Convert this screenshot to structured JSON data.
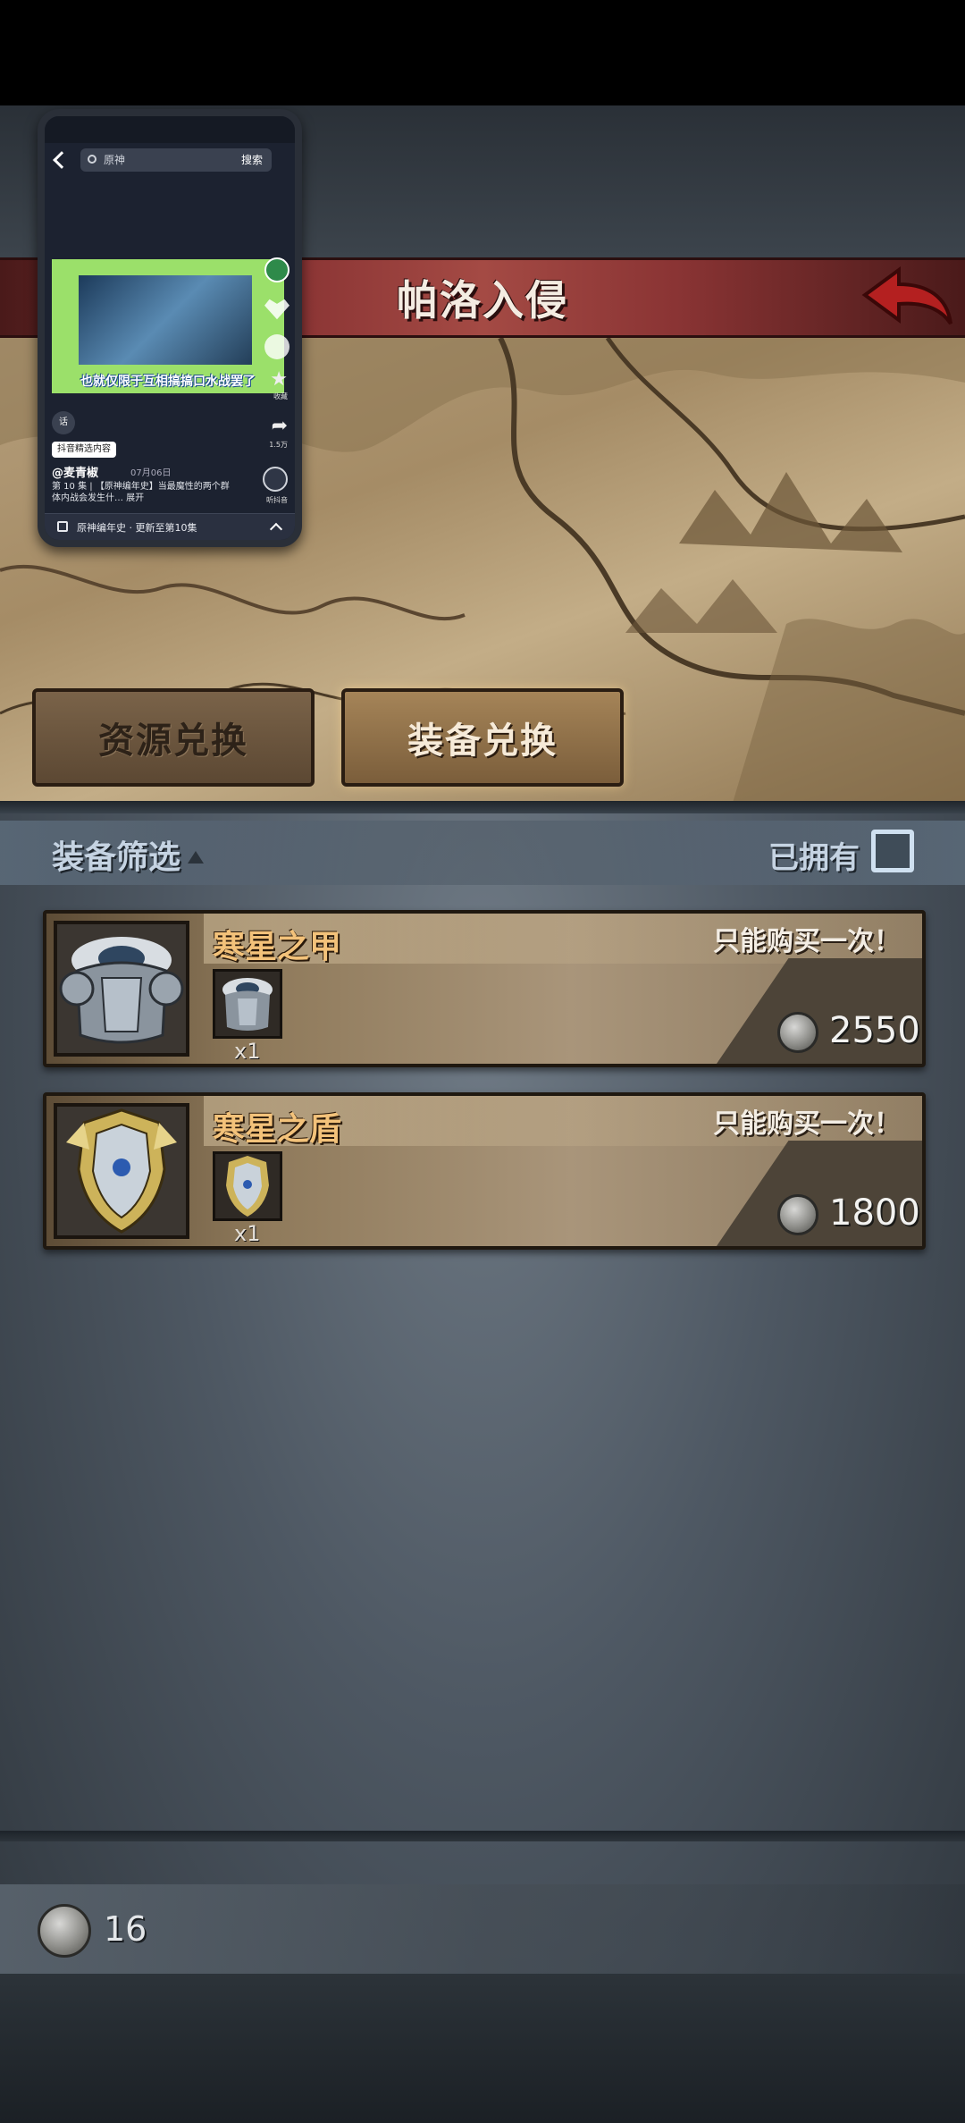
{
  "header": {
    "title": "帕洛入侵"
  },
  "tabs": [
    {
      "label": "资源兑换",
      "active": false
    },
    {
      "label": "装备兑换",
      "active": true
    }
  ],
  "filter": {
    "label": "装备筛选",
    "owned_label": "已拥有",
    "owned_checked": false
  },
  "items": [
    {
      "name": "寒星之甲",
      "note": "只能购买一次！",
      "quantity": "x1",
      "price": "2550"
    },
    {
      "name": "寒星之盾",
      "note": "只能购买一次！",
      "quantity": "x1",
      "price": "1800"
    }
  ],
  "currency": {
    "amount": "16"
  },
  "pip_window": {
    "search_text": "原神",
    "search_button": "搜索",
    "caption": "也就仅限于互相搞搞口水战罢了",
    "side_counts": {
      "star": "收藏",
      "share": "1.5万",
      "listen": "听抖音"
    },
    "icon_mini": "话",
    "tag": "抖音精选内容",
    "author": "@麦青椒",
    "date": "07月06日",
    "description": "第 10 集 | 【原神编年史】当最魔性的两个群体内战会发生什…  展开",
    "bottom_text": "原神编年史 · 更新至第10集"
  },
  "colors": {
    "banner_red": "#8a3434",
    "item_name_gold": "#f3c27a",
    "tab_active_text": "#f6ead8",
    "back_arrow_red": "#b42020"
  }
}
